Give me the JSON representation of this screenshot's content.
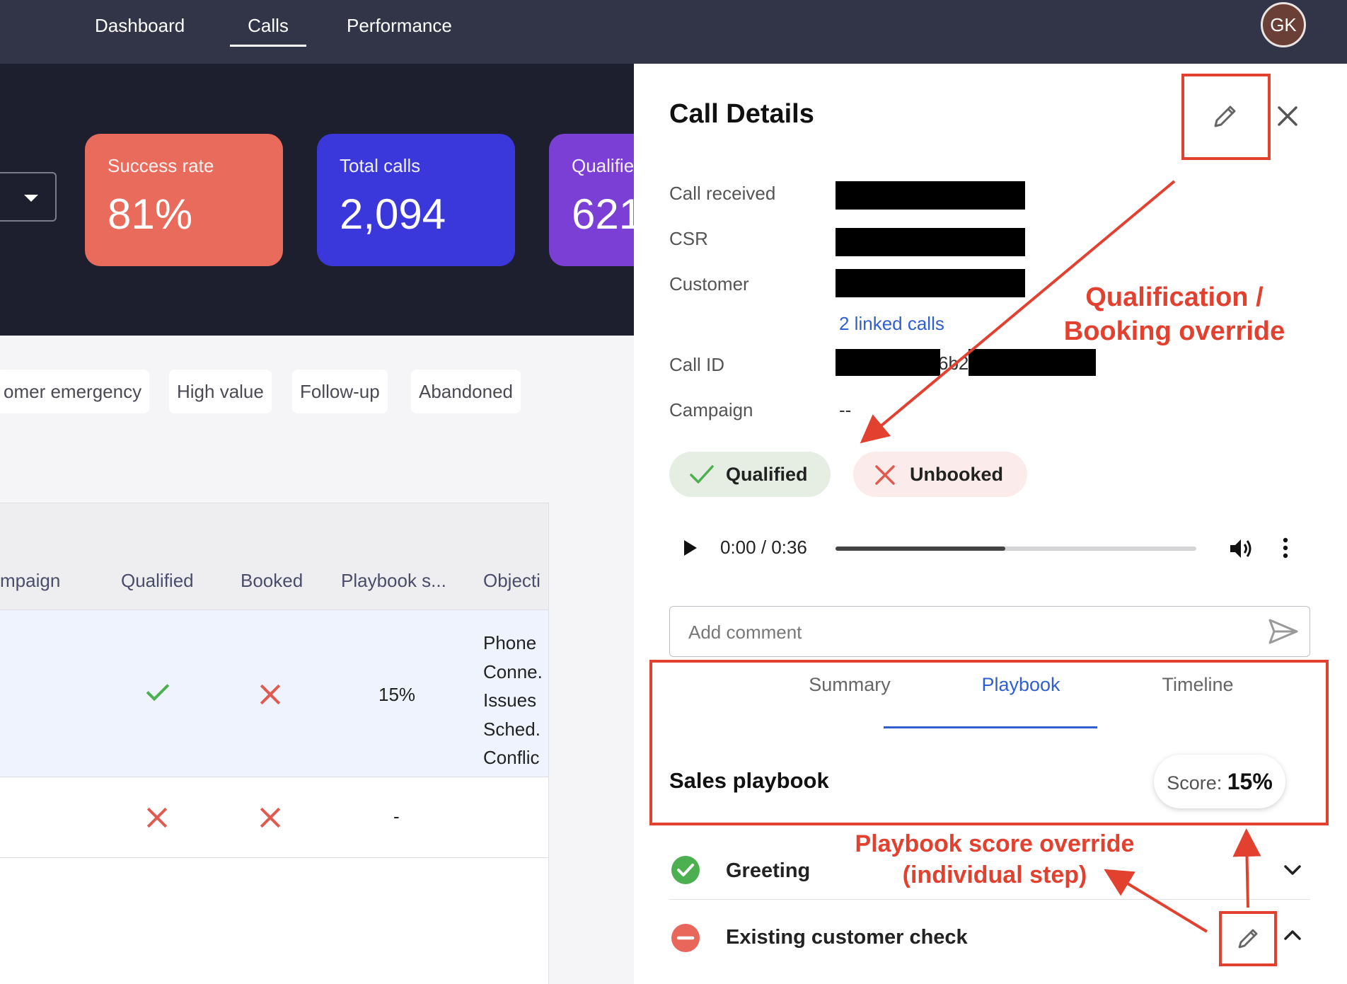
{
  "nav": {
    "items": [
      {
        "label": "Dashboard"
      },
      {
        "label": "Calls",
        "active": true
      },
      {
        "label": "Performance"
      }
    ],
    "avatar_initials": "GK"
  },
  "stats": [
    {
      "label": "Success rate",
      "value": "81%",
      "color": "#e96b5c"
    },
    {
      "label": "Total calls",
      "value": "2,094",
      "color": "#3b38db"
    },
    {
      "label": "Qualifie",
      "value": "621",
      "color": "#7b3fd6"
    }
  ],
  "tags": [
    "omer emergency",
    "High value",
    "Follow-up",
    "Abandoned"
  ],
  "table": {
    "headers": [
      "mpaign",
      "Qualified",
      "Booked",
      "Playbook s...",
      "Objecti"
    ],
    "rows": [
      {
        "qualified": true,
        "booked": false,
        "playbook_score": "15%",
        "objections": [
          "Phone",
          "Conne.",
          "Issues",
          "Sched.",
          "Conflic"
        ]
      },
      {
        "qualified": false,
        "booked": false,
        "playbook_score": "-",
        "objections": []
      }
    ]
  },
  "panel": {
    "title": "Call Details",
    "fields": [
      {
        "label": "Call received"
      },
      {
        "label": "CSR"
      },
      {
        "label": "Customer"
      },
      {
        "label": "Call ID",
        "partial_value": "6b2"
      },
      {
        "label": "Campaign",
        "value": "--"
      }
    ],
    "linked_calls": "2 linked calls",
    "qualified_label": "Qualified",
    "booked_label": "Unbooked",
    "audio": {
      "time": "0:00 / 0:36",
      "progress": 0.47
    },
    "comment_placeholder": "Add comment",
    "tabs": [
      {
        "label": "Summary"
      },
      {
        "label": "Playbook",
        "active": true
      },
      {
        "label": "Timeline"
      }
    ],
    "playbook": {
      "title": "Sales playbook",
      "score_label": "Score:",
      "score_value": "15%",
      "steps": [
        {
          "label": "Greeting",
          "status": "pass"
        },
        {
          "label": "Existing customer check",
          "status": "fail"
        }
      ]
    }
  },
  "annotations": {
    "qualification_1": "Qualification /",
    "qualification_2": "Booking override",
    "playbook_1": "Playbook score override",
    "playbook_2": "(individual step)",
    "color": "#e2412f"
  },
  "colors": {
    "nav_bg": "#323448",
    "hero_bg": "#1e1f2e",
    "accent": "#2f5fd0",
    "success": "#4caf50",
    "danger": "#e05a4e"
  }
}
